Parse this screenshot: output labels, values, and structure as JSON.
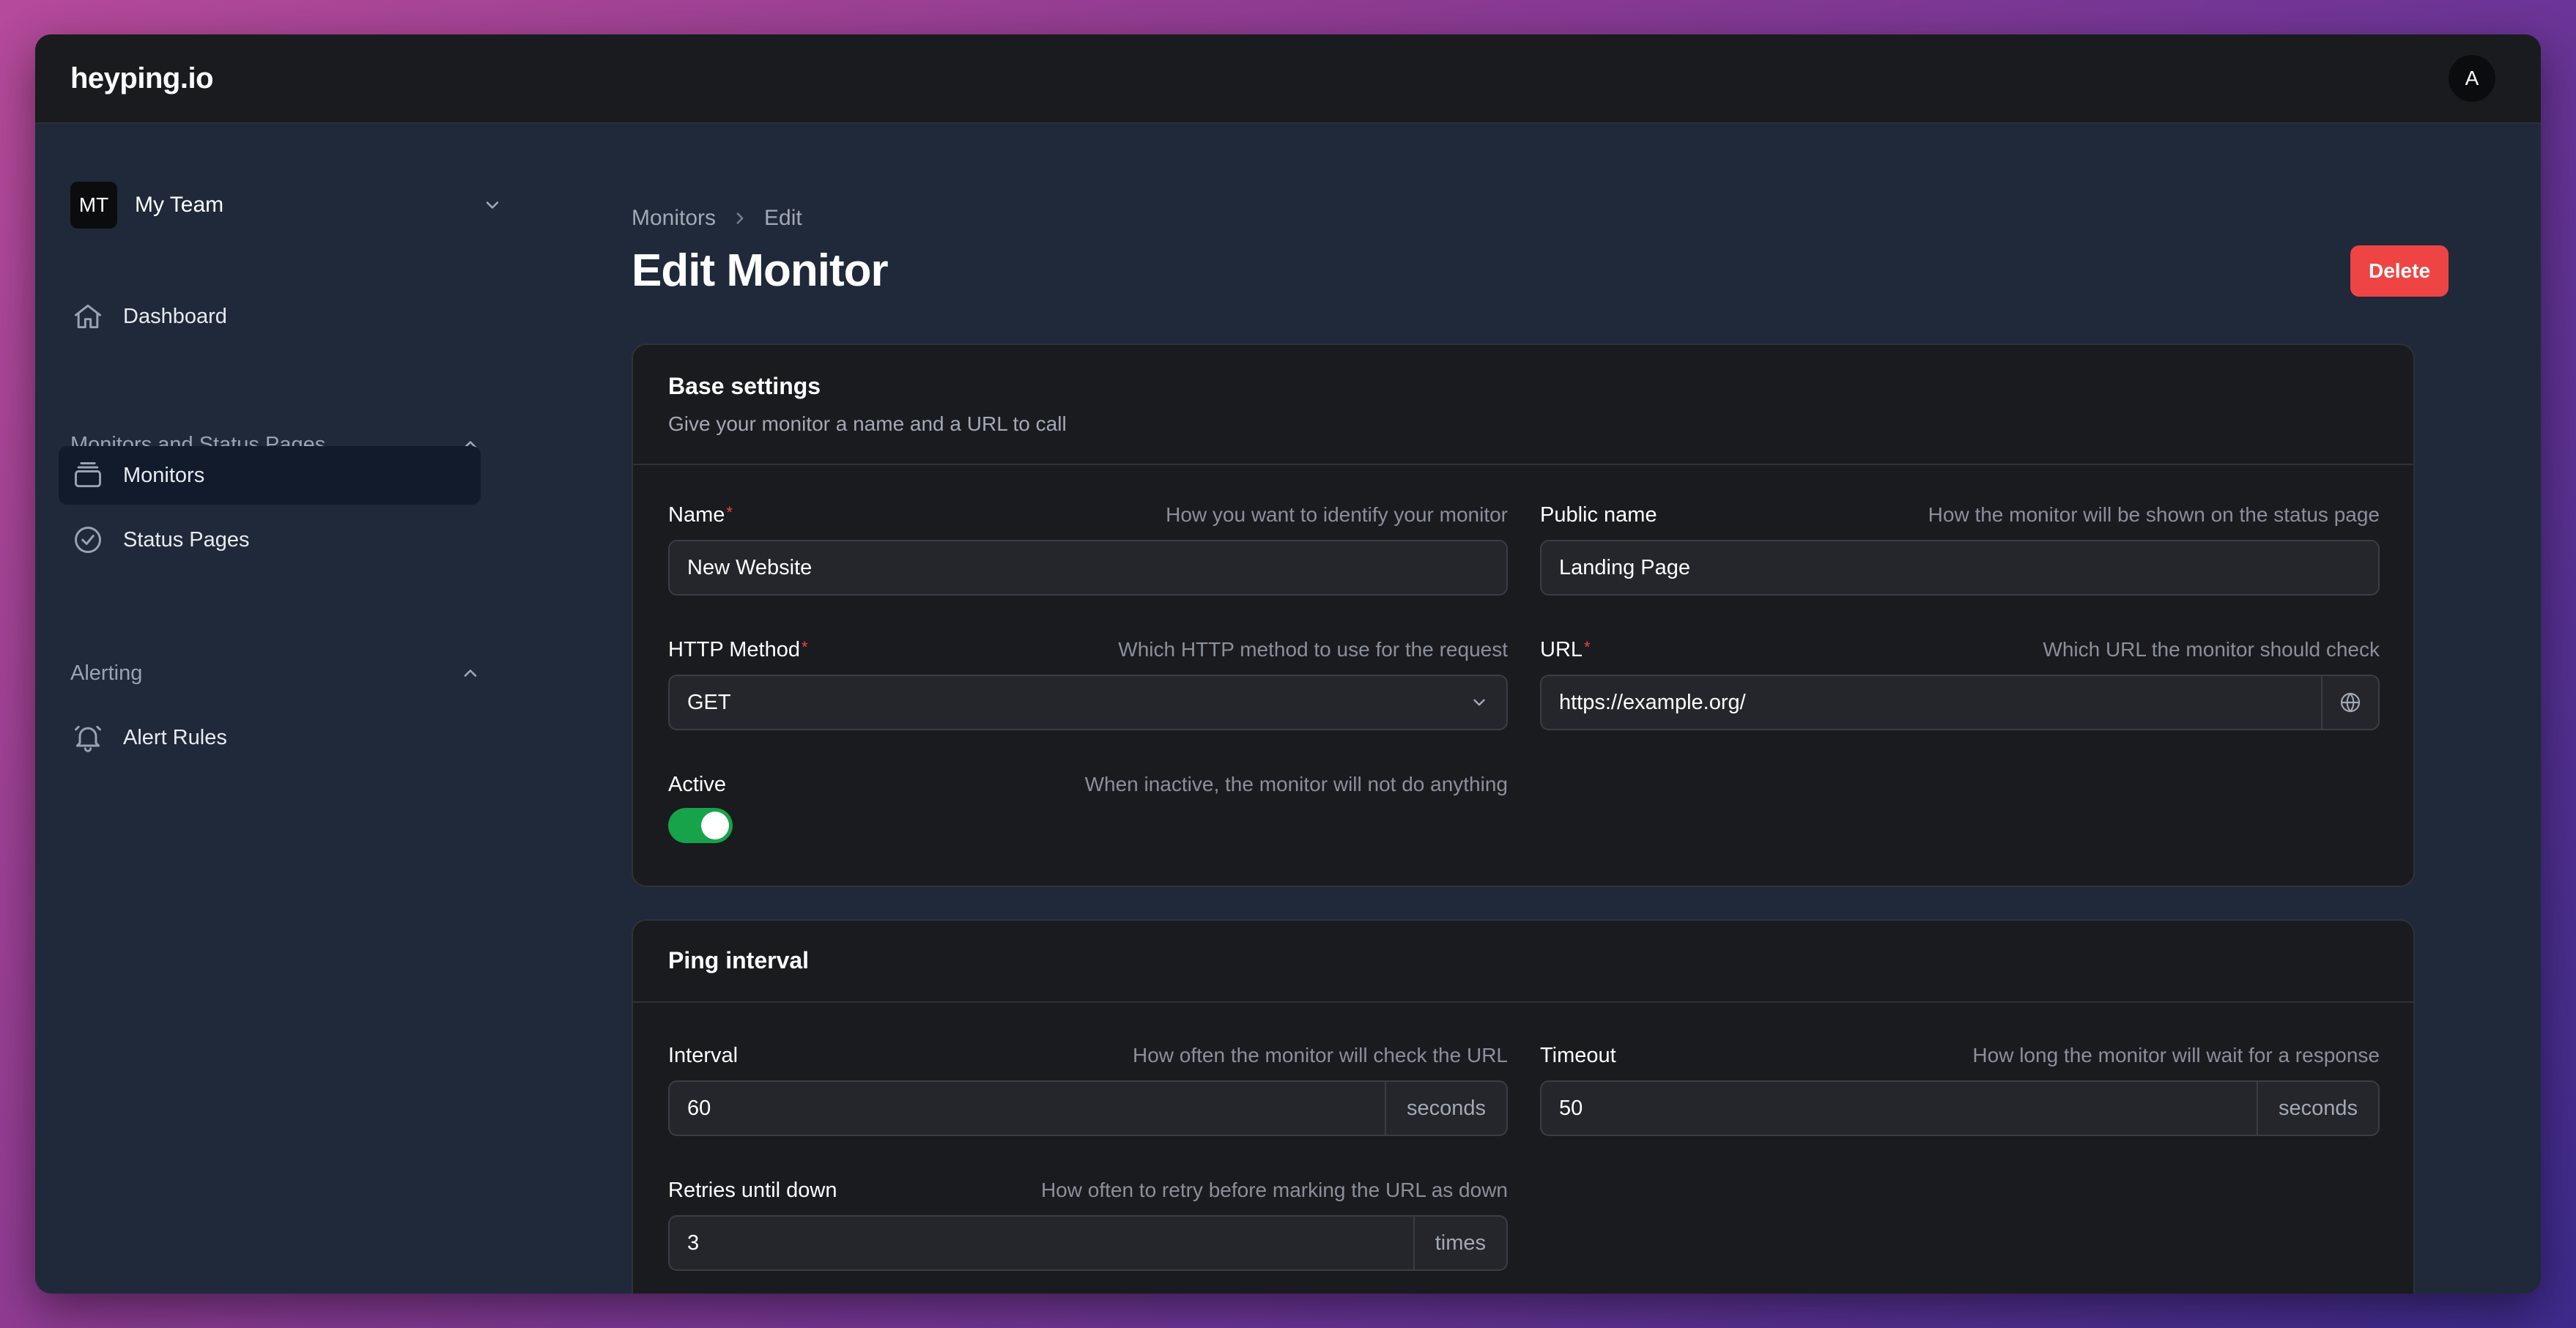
{
  "app": {
    "logo": "heyping.io",
    "avatar_initial": "A"
  },
  "sidebar": {
    "team": {
      "initials": "MT",
      "name": "My Team"
    },
    "items": [
      {
        "label": "Dashboard",
        "icon": "home-icon"
      }
    ],
    "sections": [
      {
        "title": "Monitors and Status Pages",
        "items": [
          {
            "label": "Monitors",
            "icon": "monitor-stack-icon",
            "active": true
          },
          {
            "label": "Status Pages",
            "icon": "check-circle-icon"
          }
        ]
      },
      {
        "title": "Alerting",
        "items": [
          {
            "label": "Alert Rules",
            "icon": "bell-icon"
          }
        ]
      }
    ]
  },
  "breadcrumb": {
    "parent": "Monitors",
    "current": "Edit"
  },
  "page": {
    "title": "Edit Monitor",
    "delete_label": "Delete"
  },
  "base_settings": {
    "title": "Base settings",
    "subtitle": "Give your monitor a name and a URL to call",
    "name": {
      "label": "Name",
      "hint": "How you want to identify your monitor",
      "value": "New Website"
    },
    "public_name": {
      "label": "Public name",
      "hint": "How the monitor will be shown on the status page",
      "value": "Landing Page"
    },
    "http_method": {
      "label": "HTTP Method",
      "hint": "Which HTTP method to use for the request",
      "value": "GET"
    },
    "url": {
      "label": "URL",
      "hint": "Which URL the monitor should check",
      "value": "https://example.org/"
    },
    "active": {
      "label": "Active",
      "hint": "When inactive, the monitor will not do anything",
      "on": true
    }
  },
  "ping_interval": {
    "title": "Ping interval",
    "interval": {
      "label": "Interval",
      "hint": "How often the monitor will check the URL",
      "value": "60",
      "suffix": "seconds"
    },
    "timeout": {
      "label": "Timeout",
      "hint": "How long the monitor will wait for a response",
      "value": "50",
      "suffix": "seconds"
    },
    "retries": {
      "label": "Retries until down",
      "hint": "How often to retry before marking the URL as down",
      "value": "3",
      "suffix": "times"
    }
  },
  "colors": {
    "accent_danger": "#ef4444",
    "toggle_on": "#16a34a",
    "window_bg": "#1f293a",
    "card_bg": "#1a1b1e"
  }
}
